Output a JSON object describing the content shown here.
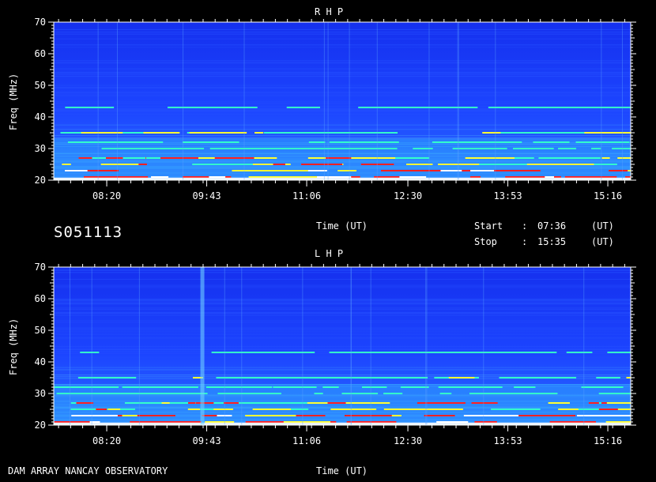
{
  "chart_data": [
    {
      "type": "heatmap",
      "title": "R H P",
      "ylabel": "Freq (MHz)",
      "xlabel": "Time (UT)",
      "ylim": [
        20,
        70
      ],
      "yticks": [
        20,
        30,
        40,
        50,
        60,
        70
      ],
      "xlim": [
        "07:36",
        "15:35"
      ],
      "xticks": [
        "08:20",
        "09:43",
        "11:06",
        "12:30",
        "13:53",
        "15:16"
      ],
      "colors": {
        "background": "#1a3cff",
        "strong": "#ff2020",
        "mid": "#ffff33",
        "weak": "#33ffcc"
      },
      "bands_mhz": [
        21,
        23,
        25,
        27,
        30,
        32,
        35,
        43
      ]
    },
    {
      "type": "heatmap",
      "title": "L H P",
      "ylabel": "Freq (MHz)",
      "xlabel": "Time (UT)",
      "ylim": [
        20,
        70
      ],
      "yticks": [
        20,
        30,
        40,
        50,
        60,
        70
      ],
      "xlim": [
        "07:36",
        "15:35"
      ],
      "xticks": [
        "08:20",
        "09:43",
        "11:06",
        "12:30",
        "13:53",
        "15:16"
      ],
      "colors": {
        "background": "#1a3cff",
        "strong": "#ff2020",
        "mid": "#ffff33",
        "weak": "#33ffcc"
      },
      "bands_mhz": [
        21,
        23,
        25,
        27,
        30,
        32,
        35,
        43
      ]
    }
  ],
  "header": {
    "id": "S051113",
    "time_label": "Time (UT)",
    "start_label": "Start",
    "start_value": "07:36",
    "stop_label": "Stop",
    "stop_value": "15:35",
    "sep": ":",
    "unit": "(UT)"
  },
  "footer": {
    "source": "DAM ARRAY  NANCAY OBSERVATORY",
    "time_label": "Time (UT)"
  }
}
